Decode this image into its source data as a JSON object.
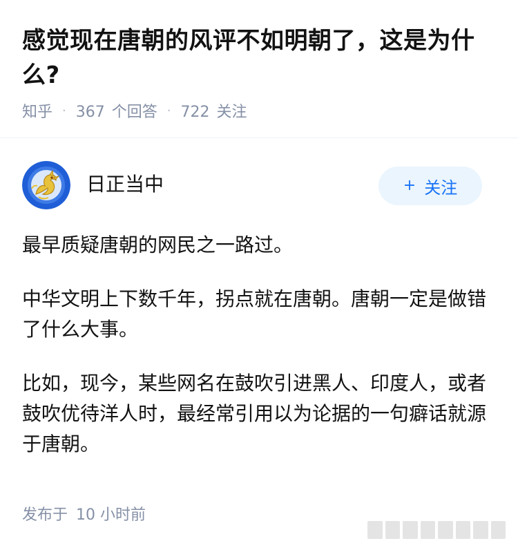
{
  "question": {
    "title": "感觉现在唐朝的风评不如明朝了，这是为什么?",
    "source": "知乎",
    "separator": "·",
    "answer_count": "367",
    "answer_label": "个回答",
    "follow_count": "722",
    "follow_label": "关注"
  },
  "answer": {
    "author": {
      "name": "日正当中",
      "avatar_icon": "dragon-avatar-icon"
    },
    "follow_button": {
      "icon": "+",
      "label": "关注"
    },
    "paragraphs": [
      "最早质疑唐朝的网民之一路过。",
      "中华文明上下数千年，拐点就在唐朝。唐朝一定是做错了什么大事。",
      "比如，现今，某些网名在鼓吹引进黑人、印度人，或者鼓吹优待洋人时，最经常引用以为论据的一句癖话就源于唐朝。"
    ],
    "publish": {
      "label": "发布于",
      "time": "10 小时前"
    }
  },
  "colors": {
    "meta_text": "#8590a6",
    "accent": "#1772f6",
    "button_bg": "#ebf5fd",
    "avatar_ring": "#1f5ed6",
    "avatar_dragon": "#e8c23a"
  }
}
